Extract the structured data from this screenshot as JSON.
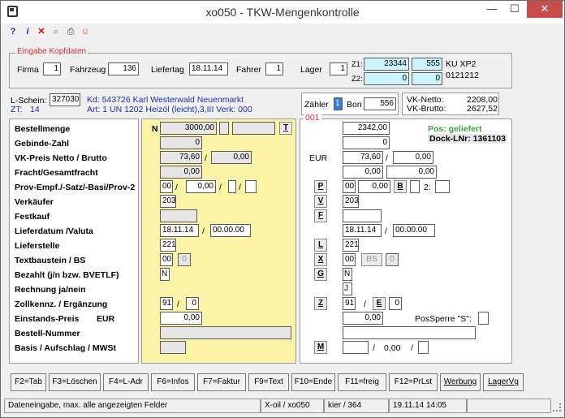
{
  "window": {
    "title": "xo050 - TKW-Mengenkontrolle",
    "minimize": "—",
    "maximize": "☐",
    "close": "✕"
  },
  "toolbar": {
    "help": "?",
    "info": "i",
    "delete": "✕",
    "search": "⌕",
    "print": "⎙",
    "user": "☺"
  },
  "header": {
    "group_title": "Eingabe Kopfdaten",
    "firma_label": "Firma",
    "firma": "1",
    "fahrzeug_label": "Fahrzeug",
    "fahrzeug": "136",
    "liefertag_label": "Liefertag",
    "liefertag": "18.11.14",
    "fahrer_label": "Fahrer",
    "fahrer": "1",
    "lager_label": "Lager",
    "lager": "1",
    "z1_label": "Z1:",
    "z1": "23344",
    "z1b": "555",
    "z1_text": "KU XP2",
    "z2_label": "Z2:",
    "z2": "0",
    "z2b": "0",
    "z2_text": "0121212"
  },
  "info": {
    "lschein_label": "L-Schein:",
    "lschein": "327030",
    "zt_label": "ZT:",
    "zt": "14",
    "kd": "Kd: 543726 Karl Westerwald Neuenmarkt",
    "art": "Art: 1 UN 1202 Heizöl (leicht),3,III Verk: 000",
    "zaehler_label": "Zähler",
    "zaehler": "1",
    "bon_label": "Bon",
    "bon": "556",
    "pos_num": "001",
    "vk_netto_label": "VK-Netto:",
    "vk_netto": "2208,00",
    "vk_brutto_label": "VK-Brutto:",
    "vk_brutto": "2627,52"
  },
  "labels": [
    "Bestellmenge",
    "Gebinde-Zahl",
    "VK-Preis Netto / Brutto",
    "Fracht/Gesamtfracht",
    "Prov-Empf./-Satz/-Basi/Prov-2",
    "Verkäufer",
    "Festkauf",
    "Lieferdatum /Valuta",
    "Lieferstelle",
    "Textbaustein / BS",
    "Bezahlt (j/n bzw. BVETLF)",
    "Rechnung ja/nein",
    "Zollkennz. / Ergänzung",
    "Einstands-Preis",
    "Bestell-Nummer",
    "Basis / Aufschlag / MWSt"
  ],
  "labels_extra": {
    "eur": "EUR"
  },
  "yellow": {
    "n_label": "N",
    "bestellmenge": "3000,00",
    "t_btn": "T",
    "gebinde": "0",
    "vk_netto": "73,60",
    "slash": "/",
    "vk_brutto": "0,00",
    "fracht": "0,00",
    "prov1": "00",
    "prov2": "0,00",
    "verkaeufer": "203",
    "lieferdatum": "18.11.14",
    "valuta": "00.00.00",
    "lieferstelle": "221",
    "textbaustein": "00",
    "bs": "0",
    "bezahlt": "N",
    "zoll1": "91",
    "zoll2": "0",
    "einstand": "0,00"
  },
  "right": {
    "menge": "2342,00",
    "gebinde": "0",
    "eur": "EUR",
    "vk_netto": "73,60",
    "vk_brutto": "0,00",
    "fracht1": "0,00",
    "fracht2": "0,00",
    "p_btn": "P",
    "prov1": "00",
    "prov2": "0,00",
    "b_btn": "B",
    "z2_label": "2:",
    "v_btn": "V",
    "verkaeufer": "203",
    "f_btn": "F",
    "lieferdatum": "18.11.14",
    "valuta": "00.00.00",
    "l_btn": "L",
    "lieferstelle": "221",
    "x_btn": "X",
    "textbaustein": "00",
    "bs_btn": "BS",
    "bs": "0",
    "g_btn": "G",
    "bezahlt": "N",
    "rechnung": "J",
    "z_btn": "Z",
    "zoll1": "91",
    "e_btn": "E",
    "zoll2": "0",
    "einstand": "0,00",
    "possperre_label": "PosSperre \"S\":",
    "m_btn": "M",
    "aufschlag": "0,00",
    "pos_status": "Pos: geliefert",
    "dock": "Dock-LNr: 1361103"
  },
  "fkeys": [
    "F2=Tab",
    "F3=Löschen",
    "F4=L-Adr",
    "F6=Infos",
    "F7=Faktur",
    "F9=Text",
    "F10=Ende",
    "F11=freig",
    "F12=PrLst",
    "Werbung",
    "LagerVg"
  ],
  "statusbar": {
    "hint": "Dateneingabe, max. alle angezeigten Felder",
    "prog": "X-oil / xo050",
    "user": "kier / 364",
    "time": "19.11.14 14:05"
  },
  "colors": {
    "yellow_panel": "#fbf3a6",
    "cyan_field": "#ccf4ff",
    "red_title": "#d03030",
    "blue_text": "#1a2fb5",
    "green_status": "#3fa03f"
  }
}
